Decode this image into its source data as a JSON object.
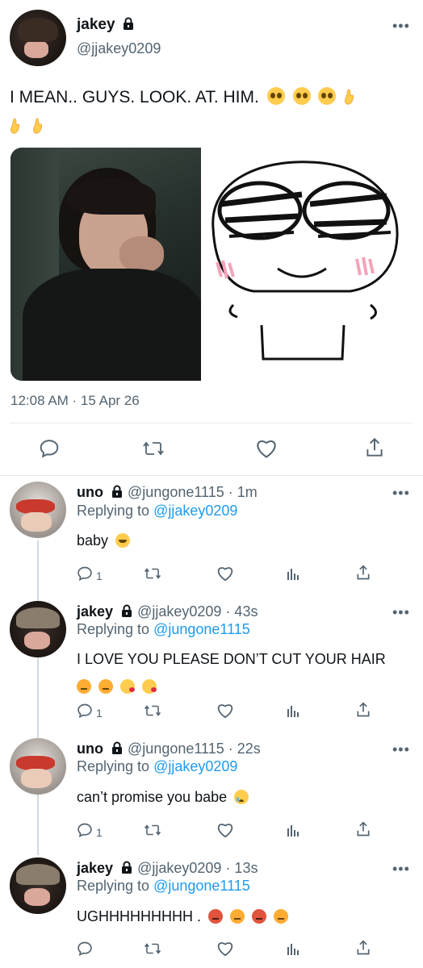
{
  "main_tweet": {
    "name": "jakey",
    "handle": "@jjakey0209",
    "text": "I MEAN.. GUYS. LOOK. AT. HIM.",
    "timestamp": "12:08 AM · 15 Apr 26"
  },
  "replies": [
    {
      "name": "uno",
      "handle": "@jungone1115",
      "time": "· 1m",
      "replying_label": "Replying to",
      "replying_to": "@jjakey0209",
      "text": "baby",
      "reply_count": "1"
    },
    {
      "name": "jakey",
      "handle": "@jjakey0209",
      "time": "· 43s",
      "replying_label": "Replying to",
      "replying_to": "@jungone1115",
      "text": "I LOVE YOU PLEASE DON’T CUT YOUR HAIR",
      "reply_count": "1"
    },
    {
      "name": "uno",
      "handle": "@jungone1115",
      "time": "· 22s",
      "replying_label": "Replying to",
      "replying_to": "@jjakey0209",
      "text": "can’t promise you babe",
      "reply_count": "1"
    },
    {
      "name": "jakey",
      "handle": "@jjakey0209",
      "time": "· 13s",
      "replying_label": "Replying to",
      "replying_to": "@jungone1115",
      "text": "UGHHHHHHHHH .",
      "reply_count": ""
    }
  ],
  "colors": {
    "link": "#1d9bf0",
    "secondary": "#536471",
    "divider": "#e7e9ea",
    "emoji": "#ffcc4d"
  },
  "icons": [
    "lock-icon",
    "more-icon",
    "reply-icon",
    "retweet-icon",
    "like-icon",
    "analytics-icon",
    "share-icon"
  ]
}
